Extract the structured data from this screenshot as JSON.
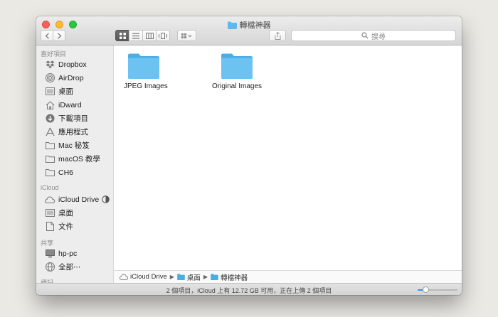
{
  "window": {
    "title": "轉檔神器"
  },
  "toolbar": {
    "search_placeholder": "搜尋"
  },
  "sidebar": {
    "favorites_header": "喜好項目",
    "favorites": [
      {
        "label": "Dropbox",
        "icon": "dropbox-icon"
      },
      {
        "label": "AirDrop",
        "icon": "airdrop-icon"
      },
      {
        "label": "桌面",
        "icon": "desktop-icon"
      },
      {
        "label": "iDward",
        "icon": "home-icon"
      },
      {
        "label": "下載項目",
        "icon": "download-icon"
      },
      {
        "label": "應用程式",
        "icon": "applications-icon"
      },
      {
        "label": "Mac 秘笈",
        "icon": "folder-icon"
      },
      {
        "label": "macOS 教學",
        "icon": "folder-icon"
      },
      {
        "label": "CH6",
        "icon": "folder-icon"
      }
    ],
    "icloud_header": "iCloud",
    "icloud": [
      {
        "label": "iCloud Drive",
        "icon": "cloud-icon"
      },
      {
        "label": "桌面",
        "icon": "desktop-icon"
      },
      {
        "label": "文件",
        "icon": "document-icon"
      }
    ],
    "shared_header": "共享",
    "shared": [
      {
        "label": "hp-pc",
        "icon": "computer-icon"
      },
      {
        "label": "全部⋯",
        "icon": "network-icon"
      }
    ],
    "tags_header": "標記"
  },
  "content": {
    "items": [
      {
        "label": "JPEG Images"
      },
      {
        "label": "Original Images"
      }
    ]
  },
  "pathbar": {
    "crumbs": [
      {
        "label": "iCloud Drive"
      },
      {
        "label": "桌面"
      },
      {
        "label": "轉檔神器"
      }
    ]
  },
  "statusbar": {
    "text": "2 個項目，iCloud 上有 12.72 GB 可用，正在上傳 2 個項目",
    "zoom_fraction": 0.2
  },
  "colors": {
    "folder": "#5fb9ec",
    "accent": "#3c8ff0"
  }
}
